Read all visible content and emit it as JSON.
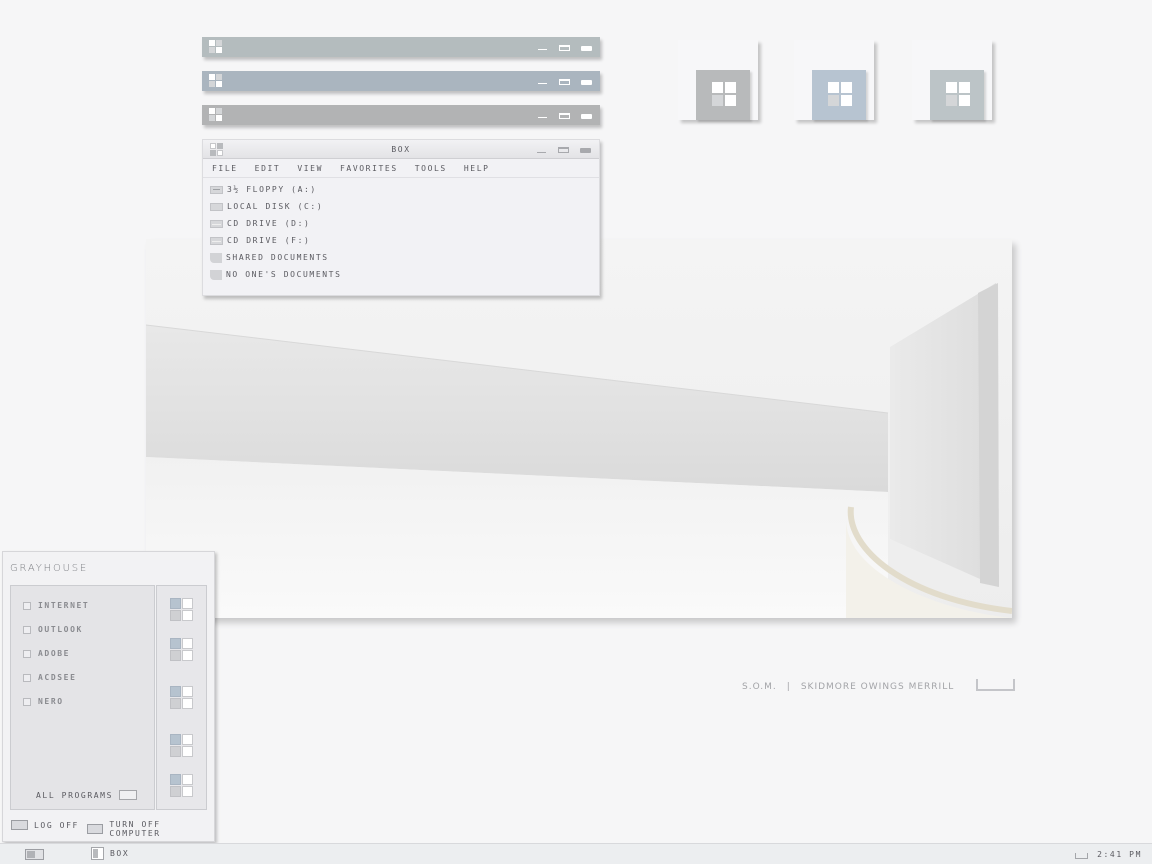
{
  "title_bars": [
    {
      "color": "#b4bcbe"
    },
    {
      "color": "#aab5bf"
    },
    {
      "color": "#b2b3b4"
    }
  ],
  "explorer": {
    "title": "BOX",
    "menu": [
      "FILE",
      "EDIT",
      "VIEW",
      "FAVORITES",
      "TOOLS",
      "HELP"
    ],
    "items": [
      {
        "label": "3½ FLOPPY (A:)",
        "icon": "floppy-drive-icon"
      },
      {
        "label": "LOCAL DISK (C:)",
        "icon": "hard-disk-icon"
      },
      {
        "label": "CD DRIVE (D:)",
        "icon": "cd-drive-icon"
      },
      {
        "label": "CD DRIVE (F:)",
        "icon": "cd-drive-icon"
      },
      {
        "label": "SHARED DOCUMENTS",
        "icon": "folder-icon"
      },
      {
        "label": "NO ONE'S DOCUMENTS",
        "icon": "folder-icon"
      }
    ]
  },
  "desktop_icons": [
    {
      "color": "#b8babb"
    },
    {
      "color": "#b7c4d1"
    },
    {
      "color": "#bcc4c7"
    }
  ],
  "caption": {
    "left": "S.O.M.",
    "separator": "|",
    "right": "SKIDMORE OWINGS MERRILL"
  },
  "start_menu": {
    "brand": "GRAYHOUSE",
    "programs": [
      "INTERNET",
      "OUTLOOK",
      "ADOBE",
      "ACDSEE",
      "NERO"
    ],
    "all_programs": "ALL PROGRAMS",
    "log_off": "LOG OFF",
    "turn_off": "TURN OFF COMPUTER"
  },
  "taskbar": {
    "task": "BOX",
    "clock": "2:41 PM"
  }
}
